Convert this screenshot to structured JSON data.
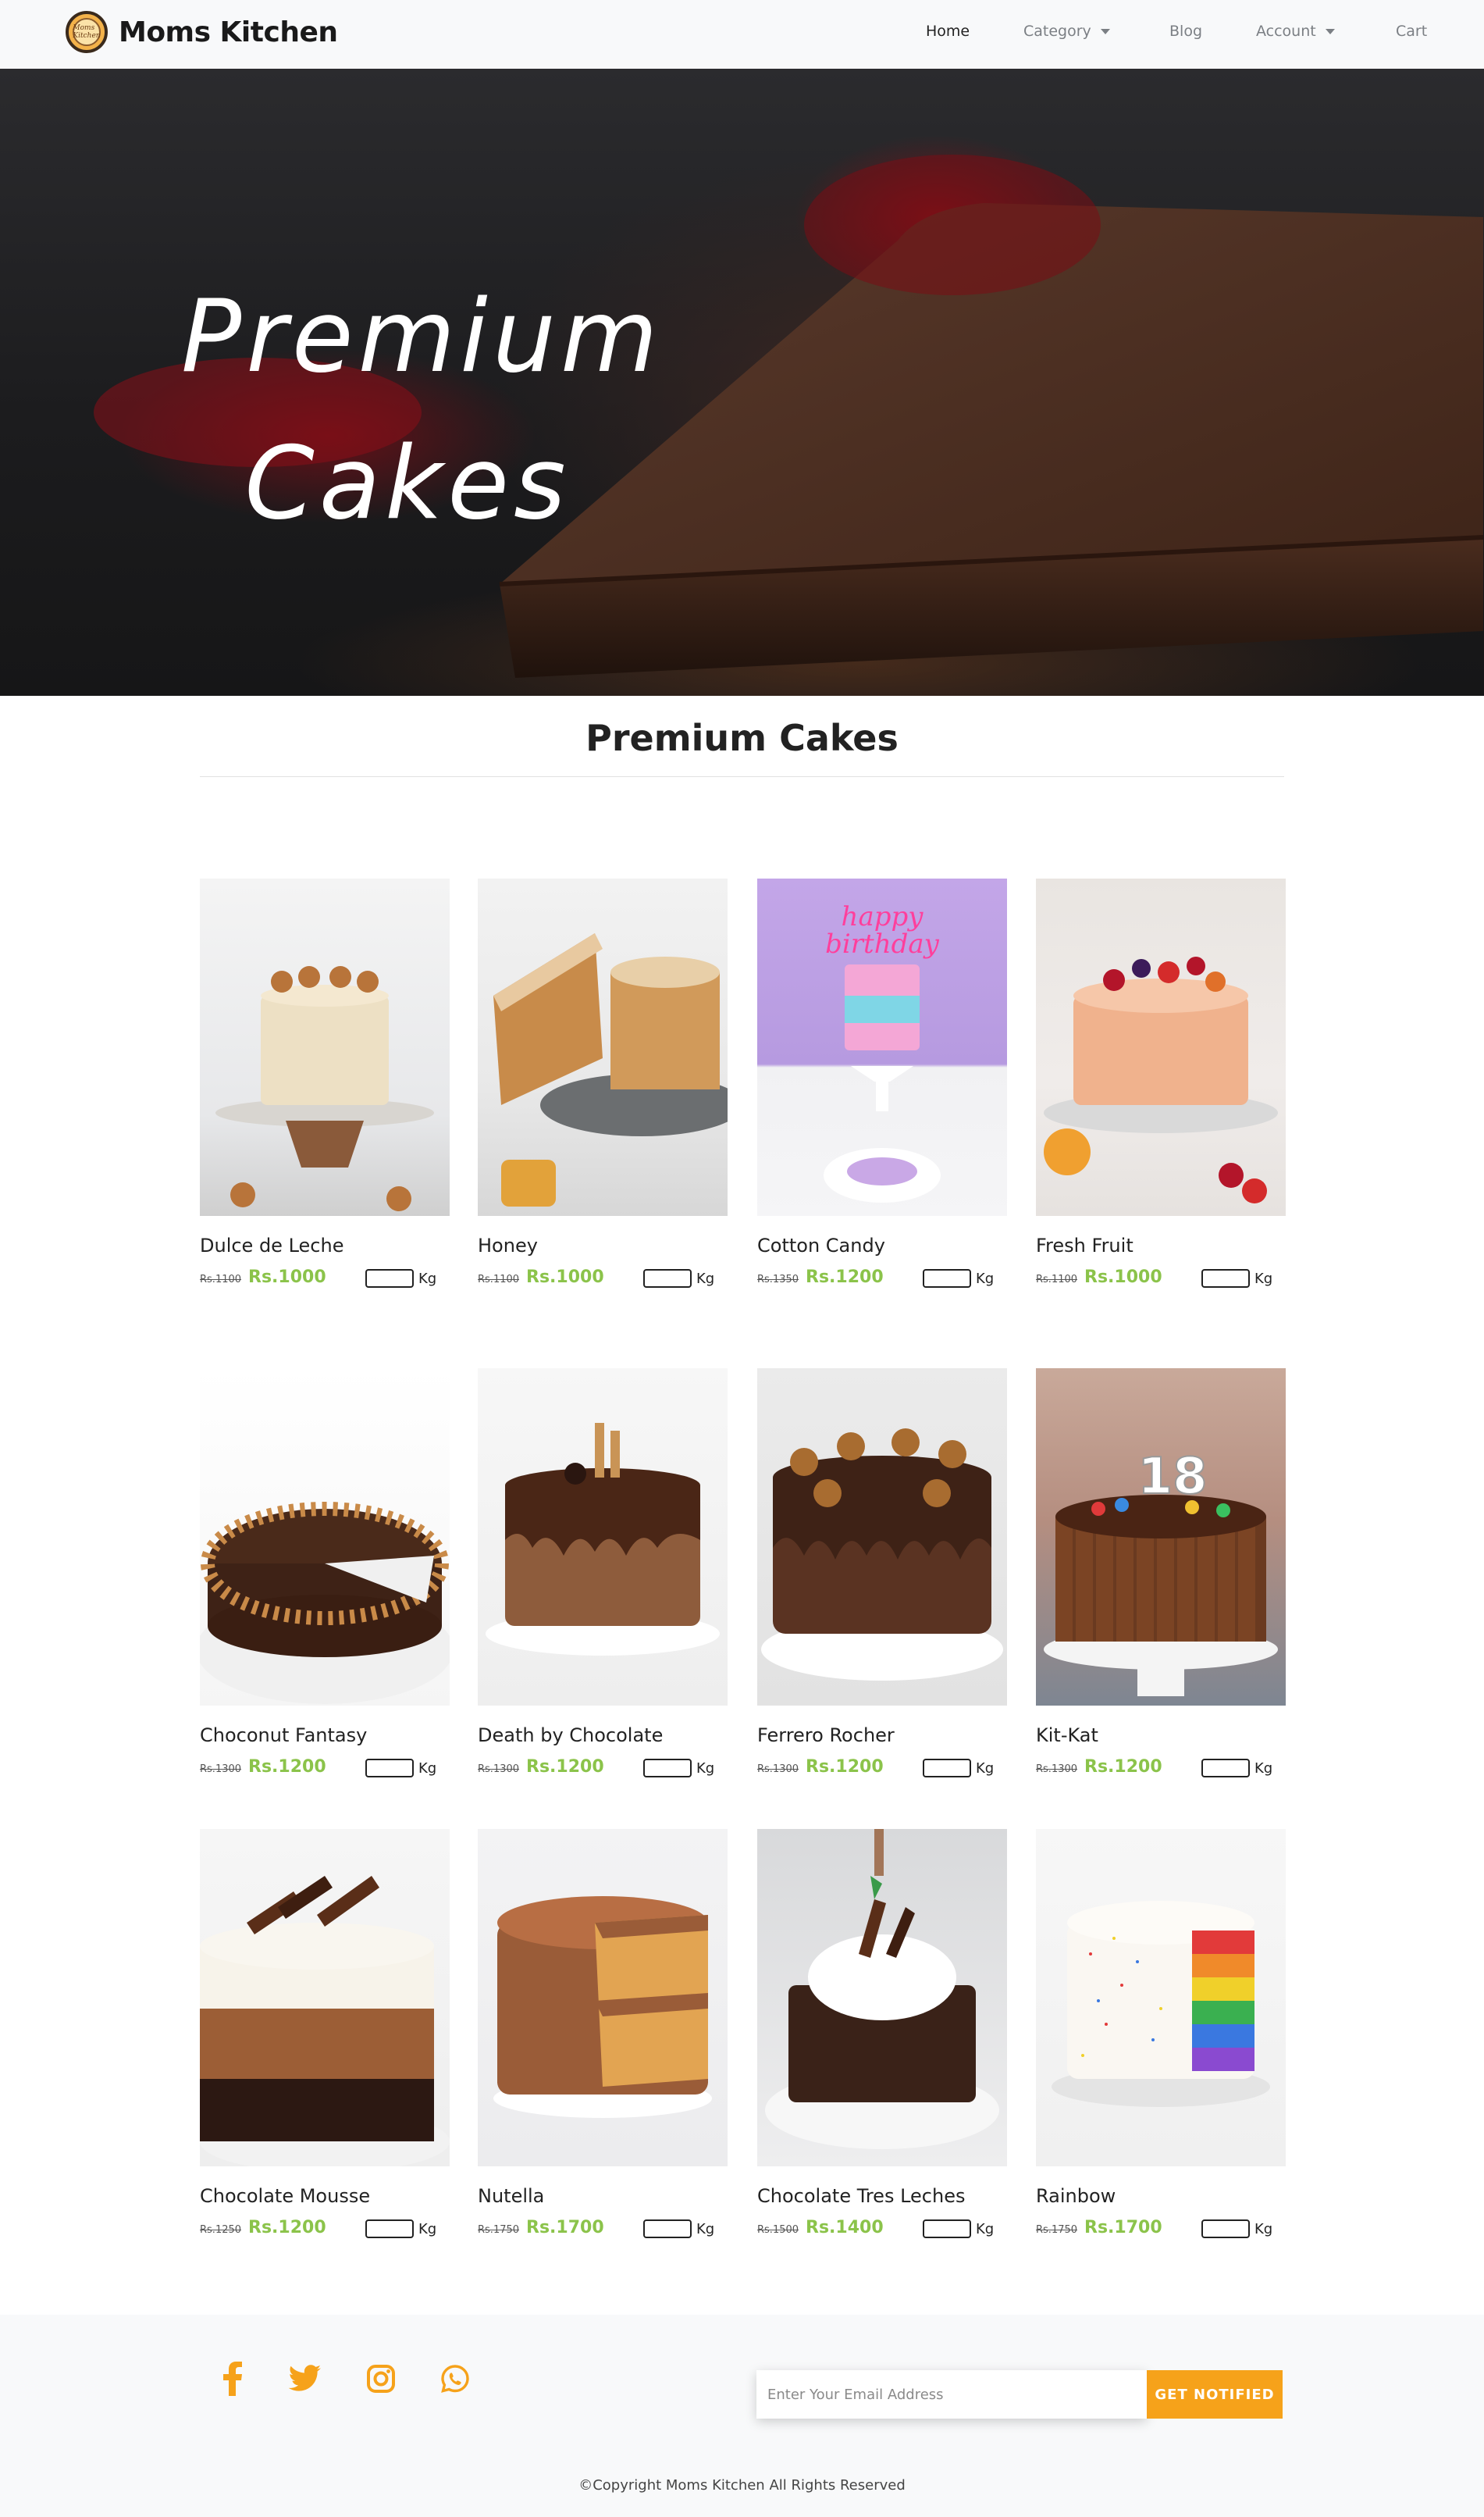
{
  "brand": {
    "name": "Moms Kitchen",
    "logo_text": "Moms Kitchen"
  },
  "nav": {
    "home": "Home",
    "category": "Category",
    "blog": "Blog",
    "account": "Account",
    "cart": "Cart"
  },
  "hero": {
    "line1": "Premium",
    "line2": "Cakes"
  },
  "section": {
    "title": "Premium Cakes"
  },
  "products": [
    {
      "name": "Dulce de Leche",
      "old_price": "Rs.1100",
      "new_price": "Rs.1000",
      "unit": "Kg"
    },
    {
      "name": "Honey",
      "old_price": "Rs.1100",
      "new_price": "Rs.1000",
      "unit": "Kg"
    },
    {
      "name": "Cotton Candy",
      "old_price": "Rs.1350",
      "new_price": "Rs.1200",
      "unit": "Kg"
    },
    {
      "name": "Fresh Fruit",
      "old_price": "Rs.1100",
      "new_price": "Rs.1000",
      "unit": "Kg"
    },
    {
      "name": "Choconut Fantasy",
      "old_price": "Rs.1300",
      "new_price": "Rs.1200",
      "unit": "Kg"
    },
    {
      "name": "Death by Chocolate",
      "old_price": "Rs.1300",
      "new_price": "Rs.1200",
      "unit": "Kg"
    },
    {
      "name": "Ferrero Rocher",
      "old_price": "Rs.1300",
      "new_price": "Rs.1200",
      "unit": "Kg"
    },
    {
      "name": "Kit-Kat",
      "old_price": "Rs.1300",
      "new_price": "Rs.1200",
      "unit": "Kg"
    },
    {
      "name": "Chocolate Mousse",
      "old_price": "Rs.1250",
      "new_price": "Rs.1200",
      "unit": "Kg"
    },
    {
      "name": "Nutella",
      "old_price": "Rs.1750",
      "new_price": "Rs.1700",
      "unit": "Kg"
    },
    {
      "name": "Chocolate Tres Leches",
      "old_price": "Rs.1500",
      "new_price": "Rs.1400",
      "unit": "Kg"
    },
    {
      "name": "Rainbow",
      "old_price": "Rs.1750",
      "new_price": "Rs.1700",
      "unit": "Kg"
    }
  ],
  "footer": {
    "email_placeholder": "Enter Your Email Address",
    "notify_label": "GET NOTIFIED",
    "copyright": "©Copyright Moms Kitchen All Rights Reserved",
    "social_icons": [
      "facebook-icon",
      "twitter-icon",
      "instagram-icon",
      "whatsapp-icon"
    ]
  },
  "colors": {
    "accent": "#f6a21a",
    "price_green": "#8bc34a",
    "navbar_bg": "#f8f9fa"
  }
}
